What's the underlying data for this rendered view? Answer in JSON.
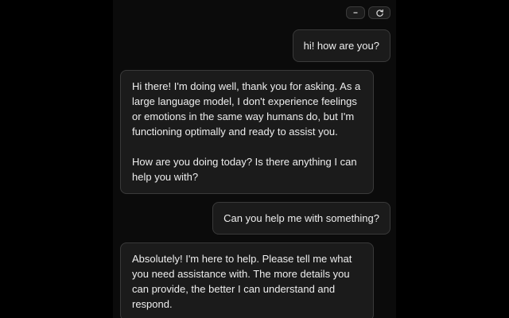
{
  "controls": {
    "minimize_icon": "minus-icon",
    "refresh_icon": "refresh-icon"
  },
  "messages": [
    {
      "role": "user",
      "text": "hi! how are you?"
    },
    {
      "role": "assistant",
      "text": "Hi there! I'm doing well, thank you for asking. As a large language model, I don't experience feelings or emotions in the same way humans do, but I'm functioning optimally and ready to assist you.\n\nHow are you doing today? Is there anything I can help you with?"
    },
    {
      "role": "user",
      "text": "Can you help me with something?"
    },
    {
      "role": "assistant",
      "text": "Absolutely! I'm here to help. Please tell me what you need assistance with. The more details you can provide, the better I can understand and respond."
    }
  ]
}
